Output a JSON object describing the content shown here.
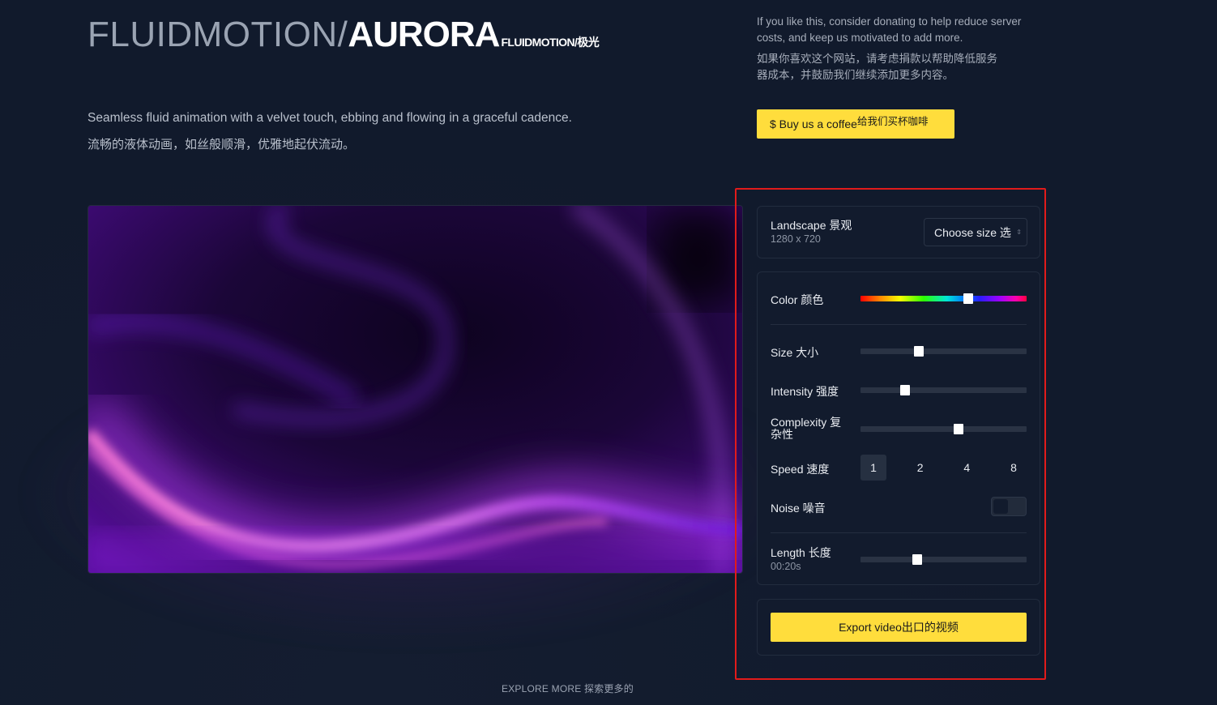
{
  "header": {
    "title_thin": "FLUIDMOTION/",
    "title_bold": "AURORA",
    "title_sub": "FLUIDMOTION/极光"
  },
  "description": {
    "en": "Seamless fluid animation with a velvet touch, ebbing and flowing in a graceful cadence.",
    "zh": "流畅的液体动画，如丝般顺滑，优雅地起伏流动。"
  },
  "donate": {
    "text_en": "If you like this, consider donating to help reduce server costs, and keep us motivated to add more.",
    "text_zh": "如果你喜欢这个网站，请考虑捐款以帮助降低服务器成本，并鼓励我们继续添加更多内容。",
    "button_label": "$ Buy us a coffee",
    "button_label_zh": "给我们买杯咖啡",
    "button_color": "#ffdd3c"
  },
  "size_card": {
    "label": "Landscape 景观",
    "dimensions": "1280 x 720",
    "select_value": "Choose size 选"
  },
  "controls": {
    "color": {
      "label": "Color 颜色",
      "value": 0.65
    },
    "size": {
      "label": "Size 大小",
      "value": 0.35
    },
    "intensity": {
      "label": "Intensity 强度",
      "value": 0.27
    },
    "complexity": {
      "label": "Complexity 复杂性",
      "value": 0.59
    },
    "speed": {
      "label": "Speed 速度",
      "options": [
        "1",
        "2",
        "4",
        "8"
      ],
      "selected": "1"
    },
    "noise": {
      "label": "Noise 噪音",
      "on": false
    },
    "length": {
      "label": "Length 长度",
      "value_text": "00:20s",
      "value": 0.34
    }
  },
  "export": {
    "button_label": "Export video出口的视频"
  },
  "footer": {
    "explore": "EXPLORE MORE 探索更多的"
  },
  "colors": {
    "accent": "#ffdd3c",
    "highlight": "#e11b1b",
    "background": "#111a2c"
  }
}
